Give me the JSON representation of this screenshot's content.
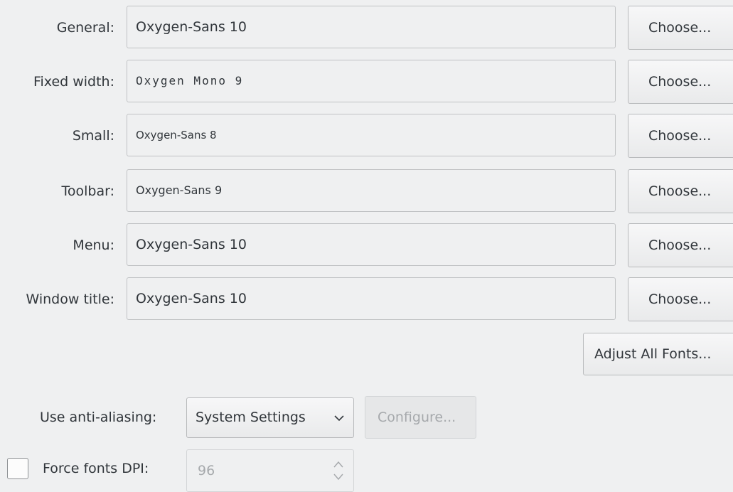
{
  "fonts": [
    {
      "key": "general",
      "label": "General:",
      "value": "Oxygen-Sans 10",
      "button": "Choose..."
    },
    {
      "key": "fixed-width",
      "label": "Fixed width:",
      "value": "Oxygen Mono 9",
      "button": "Choose..."
    },
    {
      "key": "small",
      "label": "Small:",
      "value": "Oxygen-Sans 8",
      "button": "Choose..."
    },
    {
      "key": "toolbar",
      "label": "Toolbar:",
      "value": "Oxygen-Sans 9",
      "button": "Choose..."
    },
    {
      "key": "menu",
      "label": "Menu:",
      "value": "Oxygen-Sans 10",
      "button": "Choose..."
    },
    {
      "key": "window-title",
      "label": "Window title:",
      "value": "Oxygen-Sans 10",
      "button": "Choose..."
    }
  ],
  "adjust_all_label": "Adjust All Fonts...",
  "antialias": {
    "label": "Use anti-aliasing:",
    "selected": "System Settings",
    "configure_label": "Configure...",
    "configure_enabled": false
  },
  "dpi": {
    "checkbox_label": "Force fonts DPI:",
    "checked": false,
    "value": "96",
    "enabled": false
  },
  "icons": {
    "dropdown": "chevron-down-icon",
    "spinner": "spin-arrows-icon"
  },
  "colors": {
    "background": "#eff0f1",
    "text": "#31363b",
    "disabled_text": "#a6a9ac"
  }
}
